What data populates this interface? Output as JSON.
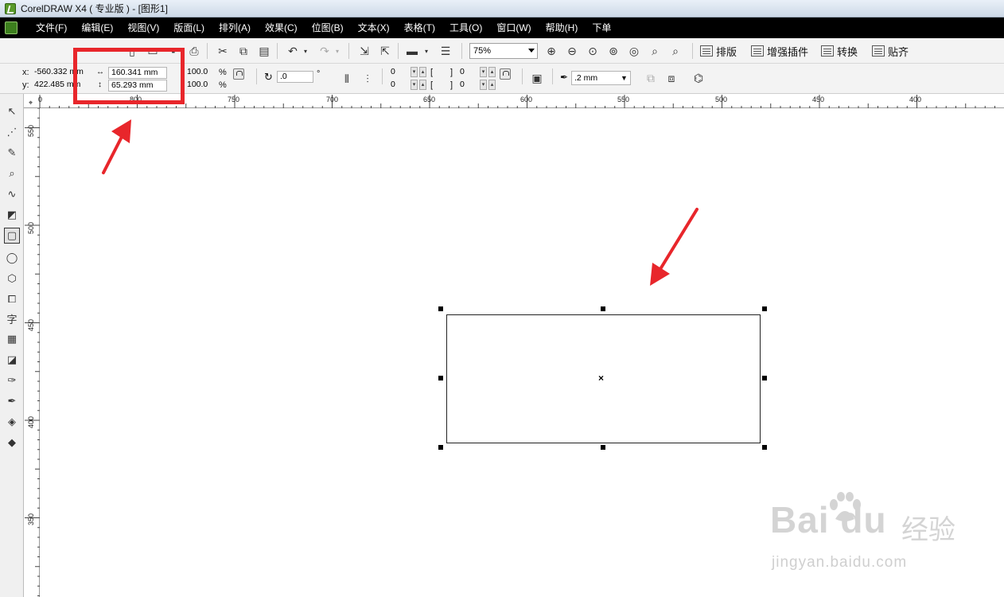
{
  "window": {
    "title": "CorelDRAW X4 ( 专业版 ) - [图形1]"
  },
  "menubar": {
    "items": [
      "文件(F)",
      "编辑(E)",
      "视图(V)",
      "版面(L)",
      "排列(A)",
      "效果(C)",
      "位图(B)",
      "文本(X)",
      "表格(T)",
      "工具(O)",
      "窗口(W)",
      "帮助(H)",
      "下单"
    ]
  },
  "toolbar": {
    "zoom": "75%",
    "plugins": [
      "排版",
      "增强插件",
      "转换",
      "贴齐"
    ]
  },
  "properties": {
    "x_label": "x:",
    "y_label": "y:",
    "x_value": "-560.332 mm",
    "y_value": "422.485 mm",
    "width_value": "160.341 mm",
    "height_value": "65.293 mm",
    "scale_x": "100.0",
    "scale_y": "100.0",
    "percent": "%",
    "rotation": ".0",
    "degree": "°",
    "corner_1": "0",
    "corner_2": "0",
    "corner_3": "0",
    "corner_4": "0",
    "outline_width": ".2 mm"
  },
  "ruler_top": [
    "0",
    "800",
    "750",
    "700",
    "650",
    "600",
    "550",
    "500",
    "450",
    "400"
  ],
  "ruler_left": [
    "550",
    "500",
    "450",
    "400",
    "350"
  ],
  "annotation": {
    "color": "#e8262b"
  },
  "watermark": {
    "main": "Bai du",
    "cn": "经验",
    "sub": "jingyan.baidu.com"
  }
}
